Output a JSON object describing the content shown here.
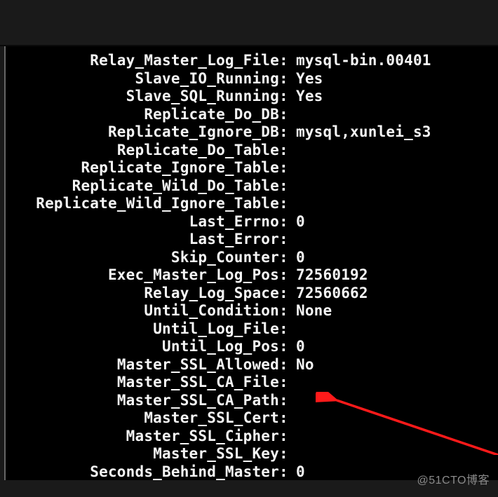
{
  "status": {
    "rows": [
      {
        "label": "Relay_Master_Log_File",
        "value": "mysql-bin.00401"
      },
      {
        "label": "Slave_IO_Running",
        "value": "Yes"
      },
      {
        "label": "Slave_SQL_Running",
        "value": "Yes"
      },
      {
        "label": "Replicate_Do_DB",
        "value": ""
      },
      {
        "label": "Replicate_Ignore_DB",
        "value": "mysql,xunlei_s3"
      },
      {
        "label": "Replicate_Do_Table",
        "value": ""
      },
      {
        "label": "Replicate_Ignore_Table",
        "value": ""
      },
      {
        "label": "Replicate_Wild_Do_Table",
        "value": ""
      },
      {
        "label": "Replicate_Wild_Ignore_Table",
        "value": ""
      },
      {
        "label": "Last_Errno",
        "value": "0"
      },
      {
        "label": "Last_Error",
        "value": ""
      },
      {
        "label": "Skip_Counter",
        "value": "0"
      },
      {
        "label": "Exec_Master_Log_Pos",
        "value": "72560192"
      },
      {
        "label": "Relay_Log_Space",
        "value": "72560662"
      },
      {
        "label": "Until_Condition",
        "value": "None"
      },
      {
        "label": "Until_Log_File",
        "value": ""
      },
      {
        "label": "Until_Log_Pos",
        "value": "0"
      },
      {
        "label": "Master_SSL_Allowed",
        "value": "No"
      },
      {
        "label": "Master_SSL_CA_File",
        "value": ""
      },
      {
        "label": "Master_SSL_CA_Path",
        "value": ""
      },
      {
        "label": "Master_SSL_Cert",
        "value": ""
      },
      {
        "label": "Master_SSL_Cipher",
        "value": ""
      },
      {
        "label": "Master_SSL_Key",
        "value": ""
      },
      {
        "label": "Seconds_Behind_Master",
        "value": "0"
      }
    ]
  },
  "watermark": "@51CTO博客"
}
